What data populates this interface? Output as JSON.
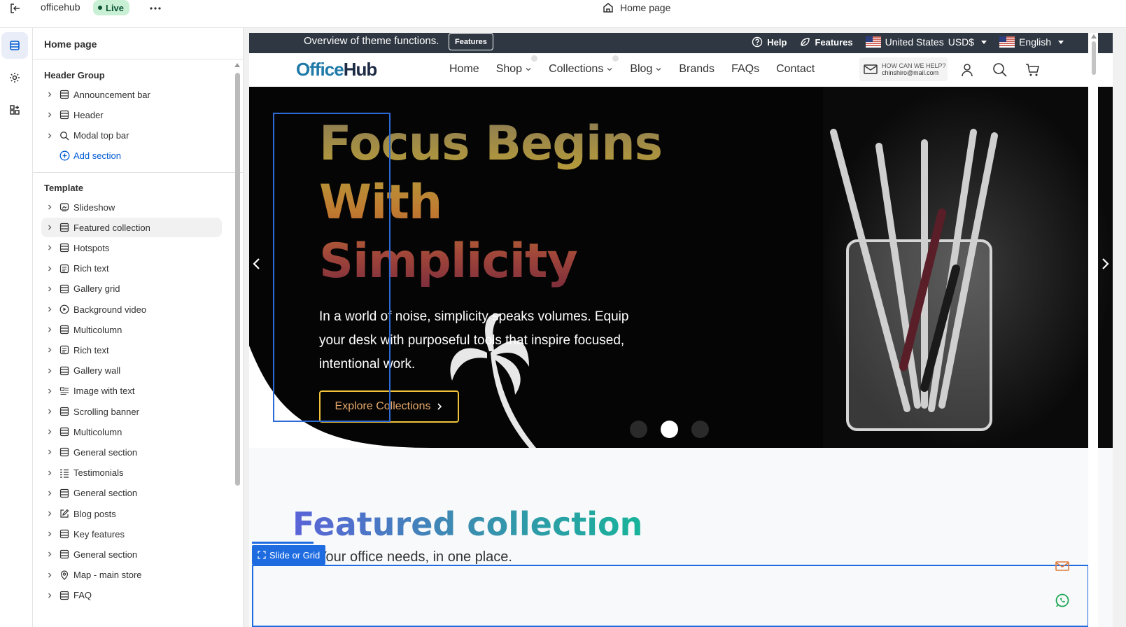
{
  "topbar": {
    "store_name": "officehub",
    "status": "Live",
    "current_page": "Home page"
  },
  "sidebar": {
    "title": "Home page",
    "header_group": {
      "title": "Header Group",
      "items": [
        {
          "label": "Announcement bar",
          "icon": "section-icon"
        },
        {
          "label": "Header",
          "icon": "section-icon"
        },
        {
          "label": "Modal top bar",
          "icon": "search-icon"
        }
      ],
      "add_label": "Add section"
    },
    "template": {
      "title": "Template",
      "items": [
        {
          "label": "Slideshow",
          "icon": "slideshow-icon"
        },
        {
          "label": "Featured collection",
          "icon": "section-icon",
          "selected": true
        },
        {
          "label": "Hotspots",
          "icon": "section-icon"
        },
        {
          "label": "Rich text",
          "icon": "text-icon"
        },
        {
          "label": "Gallery grid",
          "icon": "section-icon"
        },
        {
          "label": "Background video",
          "icon": "play-icon"
        },
        {
          "label": "Multicolumn",
          "icon": "section-icon"
        },
        {
          "label": "Rich text",
          "icon": "text-icon"
        },
        {
          "label": "Gallery wall",
          "icon": "section-icon"
        },
        {
          "label": "Image with text",
          "icon": "image-text-icon"
        },
        {
          "label": "Scrolling banner",
          "icon": "section-icon"
        },
        {
          "label": "Multicolumn",
          "icon": "section-icon"
        },
        {
          "label": "General section",
          "icon": "section-icon"
        },
        {
          "label": "Testimonials",
          "icon": "list-icon"
        },
        {
          "label": "General section",
          "icon": "section-icon"
        },
        {
          "label": "Blog posts",
          "icon": "edit-icon"
        },
        {
          "label": "Key features",
          "icon": "section-icon"
        },
        {
          "label": "General section",
          "icon": "section-icon"
        },
        {
          "label": "Map - main store",
          "icon": "location-pin-icon"
        },
        {
          "label": "FAQ",
          "icon": "section-icon"
        }
      ]
    }
  },
  "preview": {
    "announcement": {
      "text": "Overview of theme functions.",
      "button": "Features",
      "help": "Help",
      "features": "Features",
      "country": "United States",
      "currency": "USD$",
      "language": "English"
    },
    "header": {
      "logo_a": "Office",
      "logo_b": "Hub",
      "nav": [
        "Home",
        "Shop",
        "Collections",
        "Blog",
        "Brands",
        "FAQs",
        "Contact"
      ],
      "help_title": "HOW CAN WE HELP?",
      "help_email": "chinshiro@mail.com"
    },
    "hero": {
      "title": "Focus Begins With Simplicity",
      "subtitle": "In a world of noise, simplicity speaks volumes. Equip your desk with purposeful tools that inspire focused, intentional work.",
      "cta": "Explore Collections",
      "slides_count": 3,
      "active_slide": 2
    },
    "featured": {
      "title": "Featured collection",
      "subtitle": "Your office needs, in one place.",
      "tag": "Slide or Grid"
    }
  },
  "colors": {
    "accent": "#1e6ce0",
    "live_badge": "#c9f0d5",
    "announcement_bg": "#2f3742",
    "cta_border": "#f2c33a"
  }
}
